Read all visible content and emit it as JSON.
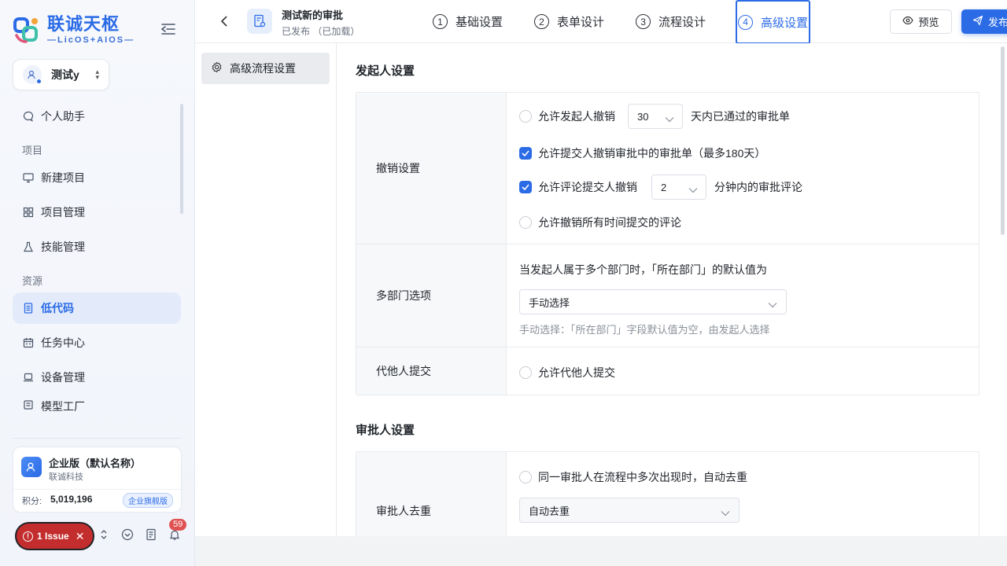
{
  "brand": {
    "title": "联诚天枢",
    "subtitle": "—LicOS+AIOS—"
  },
  "workspace": {
    "name": "测试y"
  },
  "nav": {
    "assistant": "个人助手",
    "group_project": "项目",
    "new_project": "新建项目",
    "project_manage": "项目管理",
    "skill_manage": "技能管理",
    "group_resource": "资源",
    "lowcode": "低代码",
    "task_center": "任务中心",
    "device_manage": "设备管理",
    "model_factory": "模型工厂"
  },
  "enterprise": {
    "name": "企业版（默认名称）",
    "company": "联诚科技",
    "points_label": "积分:",
    "points": "5,019,196",
    "badge": "企业旗舰版"
  },
  "issue": {
    "label": "1 Issue"
  },
  "notifications": {
    "count": "59"
  },
  "header": {
    "title": "测试新的审批",
    "status": "已发布 （已加载）",
    "preview": "预览",
    "publish": "发布"
  },
  "steps": [
    {
      "num": "1",
      "label": "基础设置"
    },
    {
      "num": "2",
      "label": "表单设计"
    },
    {
      "num": "3",
      "label": "流程设计"
    },
    {
      "num": "4",
      "label": "高级设置"
    }
  ],
  "inner_menu": {
    "item": "高级流程设置"
  },
  "initiator": {
    "title": "发起人设置",
    "revoke": {
      "label": "撤销设置",
      "opt1": "允许发起人撤销",
      "opt1_days": "30",
      "opt1_suffix": "天内已通过的审批单",
      "opt2": "允许提交人撤销审批中的审批单（最多180天）",
      "opt3": "允许评论提交人撤销",
      "opt3_minutes": "2",
      "opt3_suffix": "分钟内的审批评论",
      "opt4": "允许撤销所有时间提交的评论"
    },
    "multi_dept": {
      "label": "多部门选项",
      "desc": "当发起人属于多个部门时，「所在部门」的默认值为",
      "value": "手动选择",
      "hint": "手动选择：「所在部门」字段默认值为空，由发起人选择"
    },
    "proxy": {
      "label": "代他人提交",
      "opt": "允许代他人提交"
    }
  },
  "approver": {
    "title": "审批人设置",
    "dedup": {
      "label": "审批人去重",
      "opt": "同一审批人在流程中多次出现时，自动去重",
      "value": "自动去重"
    }
  },
  "colors": {
    "accent": "#2b6be6",
    "issue": "#c32d2d"
  }
}
